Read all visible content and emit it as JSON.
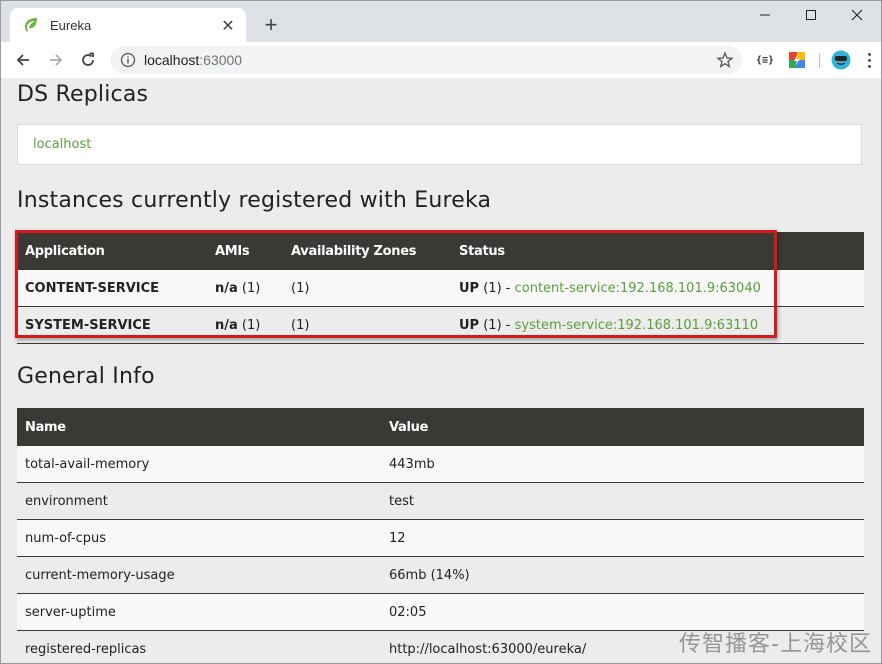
{
  "browser": {
    "tab_title": "Eureka",
    "close_glyph": "✕",
    "new_tab_glyph": "+",
    "url_host": "localhost",
    "url_port": ":63000",
    "extension_json_label": "{≡}"
  },
  "page": {
    "ds_replicas_heading": "DS Replicas",
    "replica_link": "localhost",
    "instances_heading": "Instances currently registered with Eureka",
    "instances_table": {
      "headers": [
        "Application",
        "AMIs",
        "Availability Zones",
        "Status"
      ],
      "rows": [
        {
          "application": "CONTENT-SERVICE",
          "ami_value": "n/a",
          "ami_count": " (1)",
          "zones": "(1)",
          "status_prefix": "UP",
          "status_count": " (1) - ",
          "status_link": "content-service:192.168.101.9:63040"
        },
        {
          "application": "SYSTEM-SERVICE",
          "ami_value": "n/a",
          "ami_count": " (1)",
          "zones": "(1)",
          "status_prefix": "UP",
          "status_count": " (1) - ",
          "status_link": "system-service:192.168.101.9:63110"
        }
      ]
    },
    "general_info_heading": "General Info",
    "general_table": {
      "headers": [
        "Name",
        "Value"
      ],
      "rows": [
        {
          "name": "total-avail-memory",
          "value": "443mb"
        },
        {
          "name": "environment",
          "value": "test"
        },
        {
          "name": "num-of-cpus",
          "value": "12"
        },
        {
          "name": "current-memory-usage",
          "value": "66mb (14%)"
        },
        {
          "name": "server-uptime",
          "value": "02:05"
        },
        {
          "name": "registered-replicas",
          "value": "http://localhost:63000/eureka/"
        }
      ]
    }
  },
  "watermark": "传智播客-上海校区",
  "colors": {
    "link": "#5a9e3a",
    "table_header": "#3b3935",
    "highlight": "#d8191c"
  }
}
